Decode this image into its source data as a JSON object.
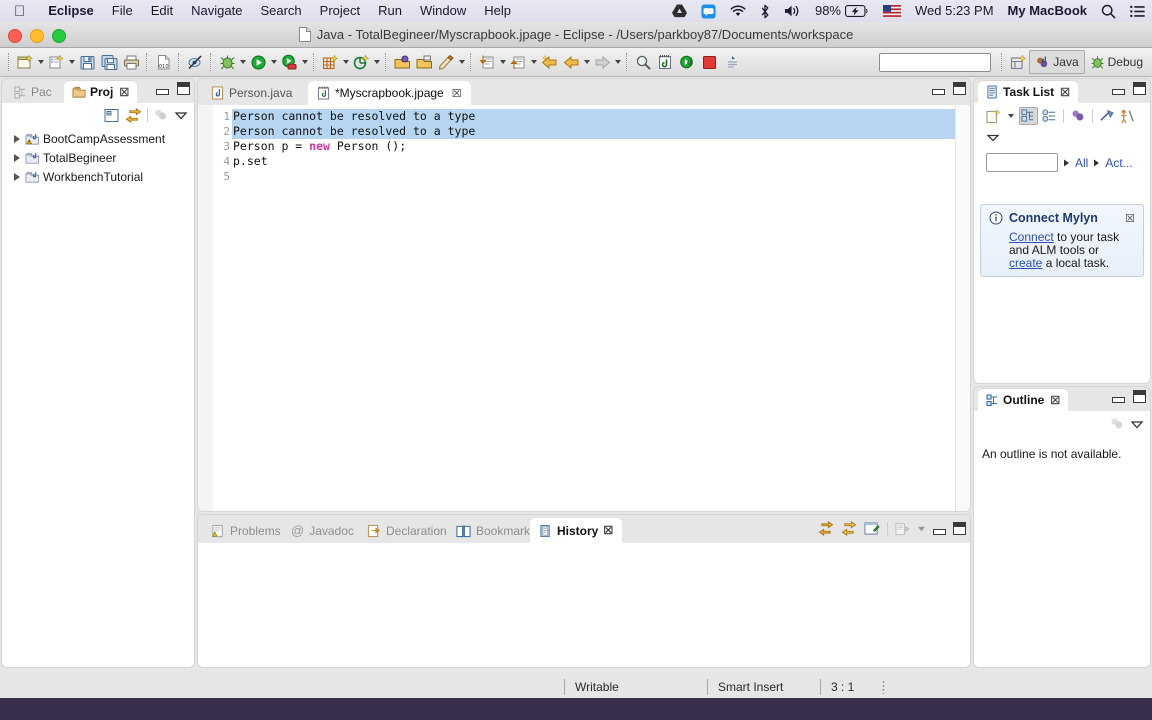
{
  "menubar": {
    "apple_icon": "apple-logo-icon",
    "items": [
      {
        "label": "Eclipse",
        "bold": true
      },
      {
        "label": "File",
        "bold": false
      },
      {
        "label": "Edit",
        "bold": false
      },
      {
        "label": "Navigate",
        "bold": false
      },
      {
        "label": "Search",
        "bold": false
      },
      {
        "label": "Project",
        "bold": false
      },
      {
        "label": "Run",
        "bold": false
      },
      {
        "label": "Window",
        "bold": false
      },
      {
        "label": "Help",
        "bold": false
      }
    ],
    "status_items": [
      {
        "name": "google-drive-icon",
        "label": ""
      },
      {
        "name": "messages-icon",
        "label": ""
      },
      {
        "name": "wifi-icon",
        "label": ""
      },
      {
        "name": "bluetooth-icon",
        "label": ""
      },
      {
        "name": "volume-icon",
        "label": ""
      },
      {
        "name": "battery-icon",
        "label": "98%"
      },
      {
        "name": "input-flag-icon",
        "label": ""
      },
      {
        "name": "clock",
        "label": "Wed 5:23 PM"
      },
      {
        "name": "user-account",
        "label": "My MacBook"
      },
      {
        "name": "spotlight-search-icon",
        "label": ""
      },
      {
        "name": "notification-center-icon",
        "label": ""
      }
    ]
  },
  "window": {
    "title": "Java - TotalBegineer/Myscrapbook.jpage - Eclipse - /Users/parkboy87/Documents/workspace",
    "traffic_lights": [
      "close-button",
      "minimize-button",
      "zoom-button"
    ]
  },
  "toolbar": {
    "perspective_field_value": "",
    "buttons": [
      {
        "name": "new-wizard-button",
        "arrow": true
      },
      {
        "name": "new-java-project-button",
        "arrow": true
      },
      {
        "name": "save-button",
        "arrow": false
      },
      {
        "name": "save-all-button",
        "arrow": false
      },
      {
        "name": "print-button",
        "arrow": false
      },
      {
        "sep": true
      },
      {
        "name": "toggle-build-button",
        "arrow": false
      },
      {
        "sep2": true
      },
      {
        "name": "skip-breakpoints-button",
        "arrow": false
      },
      {
        "sep3": true
      },
      {
        "name": "debug-button",
        "arrow": true
      },
      {
        "name": "run-button",
        "arrow": true
      },
      {
        "name": "run-coverage-button",
        "arrow": true
      },
      {
        "sep4": true
      },
      {
        "name": "new-java-class-button",
        "arrow": true
      },
      {
        "name": "new-java-package-button",
        "arrow": true
      },
      {
        "sep5": true
      },
      {
        "name": "open-type-button",
        "arrow": false
      },
      {
        "name": "open-task-button",
        "arrow": false
      },
      {
        "name": "open-element-button",
        "arrow": true
      },
      {
        "sep6": true
      },
      {
        "name": "next-annotation-button",
        "arrow": true
      },
      {
        "name": "previous-annotation-button",
        "arrow": true
      },
      {
        "sep7": true
      },
      {
        "name": "last-edit-location-button",
        "arrow": false
      },
      {
        "name": "back-button",
        "arrow": true
      },
      {
        "name": "forward-button",
        "arrow": true
      },
      {
        "sep8": true
      },
      {
        "name": "search-button",
        "arrow": false
      },
      {
        "name": "new-scrapbook-page-button",
        "arrow": false
      },
      {
        "name": "execute-snippet-button",
        "arrow": false
      },
      {
        "name": "stop-evaluation-button",
        "arrow": false
      },
      {
        "name": "display-result-button",
        "arrow": false
      }
    ],
    "perspectives": [
      {
        "label": "Java",
        "active": true,
        "icon": "java-perspective-icon"
      },
      {
        "label": "Debug",
        "active": false,
        "icon": "debug-perspective-icon"
      }
    ],
    "open_perspective_label": "open-perspective-button"
  },
  "left_view": {
    "tabs": [
      {
        "label": "Pac",
        "selected": false,
        "icon": "package-explorer-icon",
        "closable": false
      },
      {
        "label": "Proj",
        "selected": true,
        "icon": "project-explorer-icon",
        "closable": true
      }
    ],
    "close_glyph": "☒",
    "toolbar_icons": [
      {
        "name": "collapse-all-icon"
      },
      {
        "name": "link-with-editor-icon"
      },
      {
        "name": "focus-on-active-task-icon"
      },
      {
        "name": "view-menu-icon"
      }
    ],
    "tree": [
      {
        "label": "BootCampAssessment",
        "icon": "java-project-warning-icon",
        "expanded": false
      },
      {
        "label": "TotalBegineer",
        "icon": "java-project-icon",
        "expanded": false
      },
      {
        "label": "WorkbenchTutorial",
        "icon": "java-project-icon",
        "expanded": false
      }
    ]
  },
  "editor": {
    "tabs": [
      {
        "label": "Person.java",
        "selected": false,
        "icon": "java-file-icon",
        "closable": false
      },
      {
        "label": "*Myscrapbook.jpage",
        "selected": true,
        "icon": "scrapbook-page-icon",
        "closable": true
      }
    ],
    "close_glyph": "☒",
    "lines": [
      {
        "num": "1",
        "text": "Person cannot be resolved to a type",
        "highlight": true,
        "keyword": ""
      },
      {
        "num": "2",
        "text": "Person cannot be resolved to a type",
        "highlight": true,
        "keyword": ""
      },
      {
        "num": "3",
        "text": "Person p = new Person ();",
        "highlight": false,
        "keyword": "new"
      },
      {
        "num": "4",
        "text": "p.set",
        "highlight": false,
        "keyword": ""
      },
      {
        "num": "5",
        "text": "",
        "highlight": false,
        "keyword": ""
      }
    ]
  },
  "bottom_view": {
    "tabs": [
      {
        "label": "Problems",
        "selected": false,
        "icon": "problems-icon",
        "closable": false
      },
      {
        "label": "Javadoc",
        "selected": false,
        "icon": "javadoc-icon",
        "closable": false
      },
      {
        "label": "Declaration",
        "selected": false,
        "icon": "declaration-icon",
        "closable": false
      },
      {
        "label": "Bookmarks",
        "selected": false,
        "icon": "bookmarks-icon",
        "closable": false
      },
      {
        "label": "History",
        "selected": true,
        "icon": "history-icon",
        "closable": true
      }
    ],
    "close_glyph": "☒",
    "toolbar_icons": [
      {
        "name": "refresh-icon"
      },
      {
        "name": "link-with-editor-icon"
      },
      {
        "name": "pin-history-icon"
      },
      {
        "name": "compare-mode-icon"
      }
    ],
    "content": ""
  },
  "task_list": {
    "tab_label": "Task List",
    "tab_icon": "task-list-icon",
    "close_glyph": "☒",
    "toolbar_icons": [
      {
        "name": "new-task-icon"
      },
      {
        "name": "categorized-presentation-icon"
      },
      {
        "name": "scheduled-presentation-icon"
      },
      {
        "name": "focus-on-workweek-icon"
      },
      {
        "name": "synchronize-changed-icon"
      },
      {
        "name": "activate-task-icon"
      },
      {
        "name": "view-menu-icon"
      }
    ],
    "filter_value": "",
    "find_placeholder": "",
    "scope_buttons": [
      {
        "label": "All"
      },
      {
        "label": "Act..."
      }
    ],
    "mylyn": {
      "icon": "info-icon",
      "title": "Connect Mylyn",
      "close_glyph": "☒",
      "text_parts": [
        {
          "text": "Connect",
          "link": true
        },
        {
          "text": " to your task and ALM tools or ",
          "link": false
        },
        {
          "text": "create",
          "link": true
        },
        {
          "text": " a local task.",
          "link": false
        }
      ]
    }
  },
  "outline": {
    "tab_label": "Outline",
    "tab_icon": "outline-icon",
    "close_glyph": "☒",
    "toolbar_icons": [
      {
        "name": "focus-on-active-task-icon"
      },
      {
        "name": "view-menu-icon"
      }
    ],
    "message": "An outline is not available."
  },
  "statusbar": {
    "writable": "Writable",
    "insert_mode": "Smart Insert",
    "position": "3 : 1"
  },
  "colors": {
    "selection_highlight": "#b5d5f0",
    "keyword": "#d3369b",
    "link": "#2a4fb8",
    "mylyn_title": "#1e3a6e",
    "desktop": "#3a2f4a"
  }
}
